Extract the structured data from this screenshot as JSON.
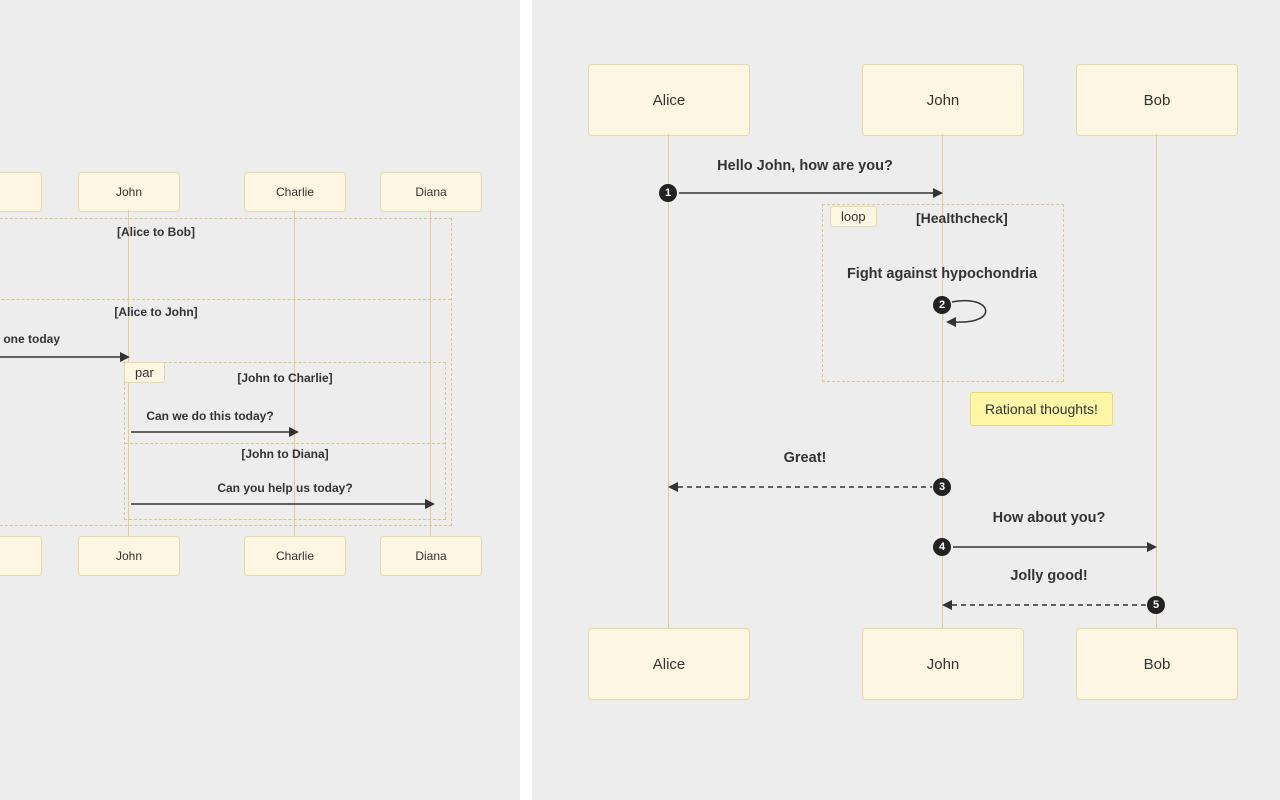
{
  "left": {
    "actors": [
      "John",
      "Charlie",
      "Diana"
    ],
    "fragments": {
      "outer_sections": [
        "[Alice to Bob]",
        "[Alice to John]"
      ],
      "inner_label": "par",
      "inner_sections": [
        "[John to Charlie]",
        "[John to Diana]"
      ]
    },
    "messages": {
      "m1_partial": "one today",
      "m2": "Can we do this today?",
      "m3": "Can you help us today?"
    }
  },
  "right": {
    "actors": [
      "Alice",
      "John",
      "Bob"
    ],
    "loop": {
      "label": "loop",
      "title": "[Healthcheck]",
      "msg": "Fight against hypochondria"
    },
    "note": "Rational thoughts!",
    "messages": {
      "m1": "Hello John, how are you?",
      "m3": "Great!",
      "m4": "How about you?",
      "m5": "Jolly good!"
    },
    "seq": {
      "s1": "1",
      "s2": "2",
      "s3": "3",
      "s4": "4",
      "s5": "5"
    }
  },
  "chart_data": [
    {
      "type": "sequence-diagram",
      "title": "Parallel fragment (left panel, partially visible)",
      "actors": [
        "Alice",
        "Bob",
        "John",
        "Charlie",
        "Diana"
      ],
      "fragments": [
        {
          "kind": "par",
          "label": "par (outer)",
          "sections": [
            "Alice to Bob",
            "Alice to John"
          ]
        },
        {
          "kind": "par",
          "label": "par",
          "sections": [
            "John to Charlie",
            "John to Diana"
          ]
        }
      ],
      "messages": [
        {
          "seq": null,
          "from": "Alice",
          "to": "John",
          "text": "... one today",
          "style": "solid"
        },
        {
          "seq": null,
          "from": "John",
          "to": "Charlie",
          "text": "Can we do this today?",
          "style": "solid"
        },
        {
          "seq": null,
          "from": "John",
          "to": "Diana",
          "text": "Can you help us today?",
          "style": "solid"
        }
      ]
    },
    {
      "type": "sequence-diagram",
      "title": "Loop / Healthcheck (right panel)",
      "actors": [
        "Alice",
        "John",
        "Bob"
      ],
      "fragments": [
        {
          "kind": "loop",
          "label": "loop",
          "title": "Healthcheck",
          "note": "Fight against hypochondria"
        }
      ],
      "notes": [
        {
          "attached_to": "John",
          "text": "Rational thoughts!"
        }
      ],
      "messages": [
        {
          "seq": 1,
          "from": "Alice",
          "to": "John",
          "text": "Hello John, how are you?",
          "style": "solid"
        },
        {
          "seq": 2,
          "from": "John",
          "to": "John",
          "text": "Fight against hypochondria",
          "style": "self-loop"
        },
        {
          "seq": 3,
          "from": "John",
          "to": "Alice",
          "text": "Great!",
          "style": "dashed"
        },
        {
          "seq": 4,
          "from": "John",
          "to": "Bob",
          "text": "How about you?",
          "style": "solid"
        },
        {
          "seq": 5,
          "from": "Bob",
          "to": "John",
          "text": "Jolly good!",
          "style": "dashed"
        }
      ]
    }
  ]
}
